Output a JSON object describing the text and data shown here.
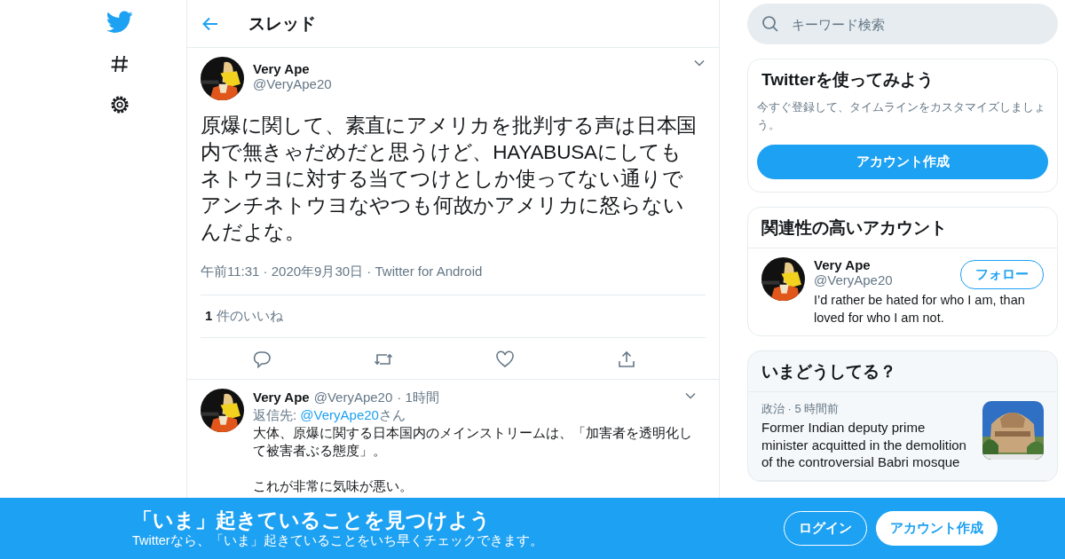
{
  "header": {
    "title": "スレッド"
  },
  "tweet": {
    "name": "Very Ape",
    "handle": "@VeryApe20",
    "text": "原爆に関して、素直にアメリカを批判する声は日本国内で無きゃだめだと思うけど、HAYABUSAにしてもネトウヨに対する当てつけとしか使ってない通りでアンチネトウヨなやつも何故かアメリカに怒らないんだよな。",
    "meta": "午前11:31 · 2020年9月30日 · Twitter for Android",
    "likes_count": "1",
    "likes_label": "件のいいね"
  },
  "reply": {
    "name": "Very Ape",
    "handle": "@VeryApe20",
    "age": "· 1時間",
    "reply_to_label": "返信先:",
    "reply_to_handle": "@VeryApe20",
    "reply_to_suffix": "さん",
    "paragraphs": [
      "大体、原爆に関する日本国内のメインストリームは、「加害者を透明化して被害者ぶる態度」。",
      "これが非常に気味が悪い。"
    ]
  },
  "search": {
    "placeholder": "キーワード検索"
  },
  "signup_card": {
    "title": "Twitterを使ってみよう",
    "text": "今すぐ登録して、タイムラインをカスタマイズしましょう。",
    "button": "アカウント作成"
  },
  "related": {
    "title": "関連性の高いアカウント",
    "accounts": [
      {
        "name": "Very Ape",
        "handle": "@VeryApe20",
        "bio": "I’d rather be hated for who I am, than loved for who I am not.",
        "button": "フォロー"
      }
    ]
  },
  "trends": {
    "title": "いまどうしてる？",
    "items": [
      {
        "kind": "news",
        "meta": "政治 · 5 時間前",
        "headline": "Former Indian deputy prime minister acquitted in the demolition of the controversial Babri mosque"
      }
    ]
  },
  "banner": {
    "title": "「いま」起きていることを見つけよう",
    "subtitle": "Twitterなら、「いま」起きていることをいち早くチェックできます。",
    "buttons": [
      {
        "kind": "outline",
        "label": "ログイン"
      },
      {
        "kind": "filled",
        "label": "アカウント作成"
      }
    ]
  }
}
